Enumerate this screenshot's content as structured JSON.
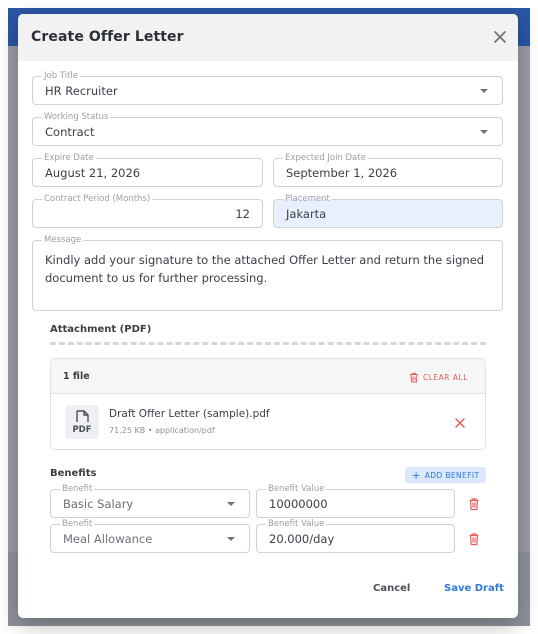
{
  "dialog": {
    "title": "Create Offer Letter"
  },
  "form": {
    "job_title": {
      "label": "Job Title",
      "value": "HR Recruiter"
    },
    "working_status": {
      "label": "Working Status",
      "value": "Contract"
    },
    "expire_date": {
      "label": "Expire Date",
      "value": "August 21, 2026"
    },
    "expected_join_date": {
      "label": "Expected Join Date",
      "value": "September 1, 2026"
    },
    "contract_period": {
      "label": "Contract Period (Months)",
      "value": "12"
    },
    "placement": {
      "label": "Placement",
      "value": "Jakarta"
    },
    "message": {
      "label": "Message",
      "value": "Kindly add your signature to the attached Offer Letter and return the signed document to us for further processing."
    }
  },
  "attachment": {
    "label": "Attachment (PDF)",
    "file_count": "1 file",
    "clear_all_label": "CLEAR ALL",
    "file": {
      "icon_text": "PDF",
      "name": "Draft Offer Letter (sample).pdf",
      "meta": "71.25 KB • application/pdf"
    }
  },
  "benefits": {
    "label": "Benefits",
    "add_label": "ADD BENEFIT",
    "add_icon": "+",
    "items": [
      {
        "benefit_label": "Benefit",
        "benefit": "Basic Salary",
        "value_label": "Benefit Value",
        "value": "10000000"
      },
      {
        "benefit_label": "Benefit",
        "benefit": "Meal Allowance",
        "value_label": "Benefit Value",
        "value": "20.000/day"
      }
    ]
  },
  "actions": {
    "cancel_label": "Cancel",
    "save_label": "Save Draft"
  },
  "colors": {
    "accent": "#2e7bd8",
    "danger": "#e85c5c",
    "header_bar": "#2a56a5",
    "placement_fill": "#e8f0fd"
  }
}
